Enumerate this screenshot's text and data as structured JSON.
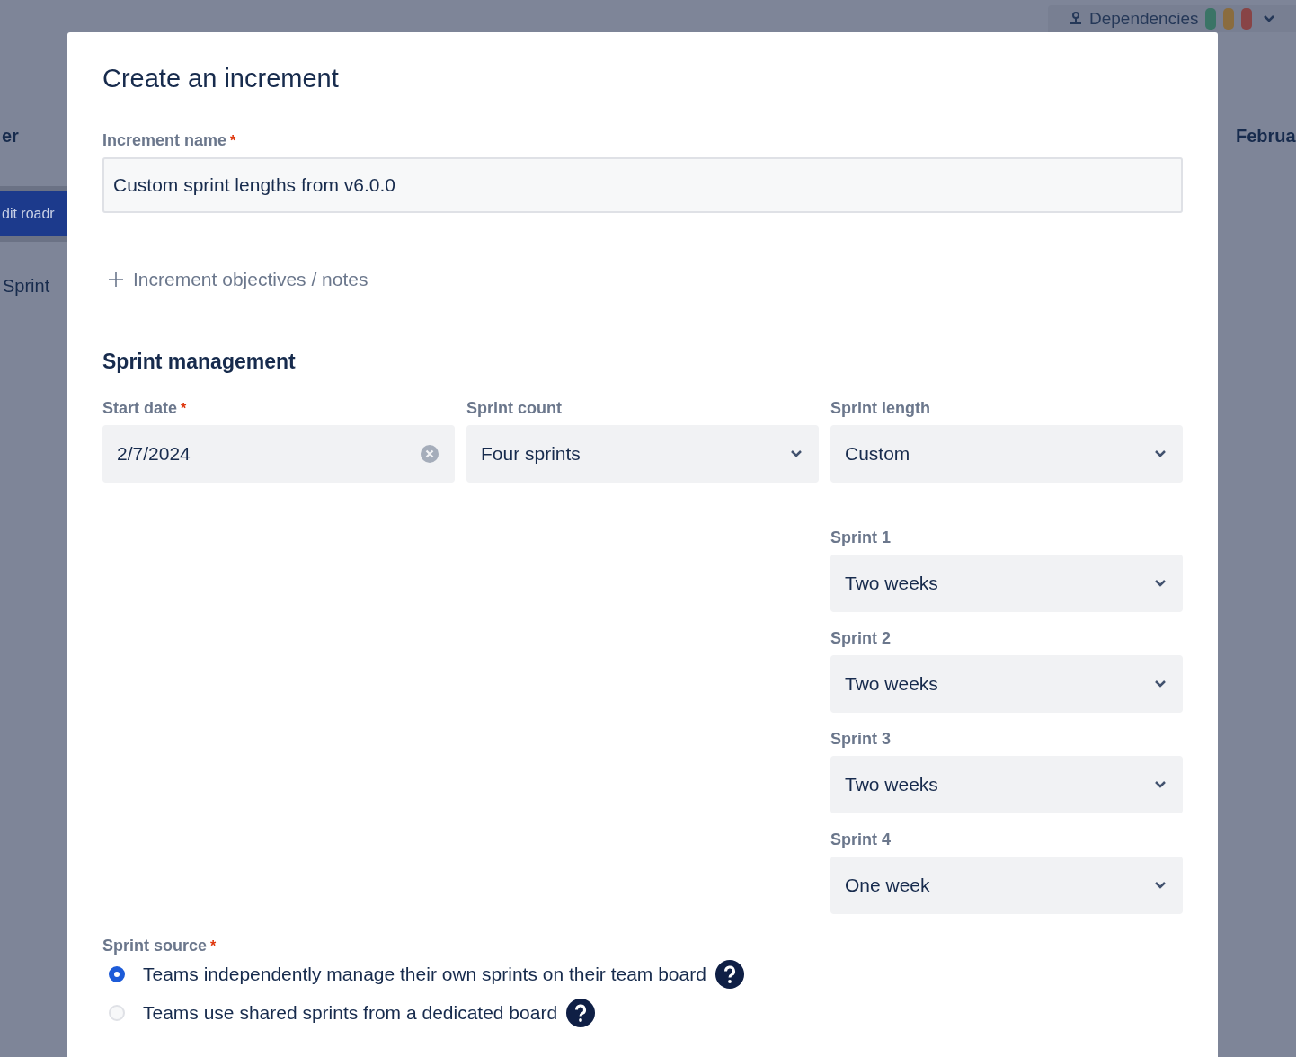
{
  "background": {
    "toolbar_label": "Dependencies",
    "status_pills": [
      {
        "color": "#3b7466"
      },
      {
        "color": "#8a6c3e"
      },
      {
        "color": "#884446"
      }
    ],
    "left_heading": "er",
    "left_button": "dit roadr",
    "left_item": "Sprint",
    "right_heading": "Februa"
  },
  "dialog": {
    "title": "Create an increment",
    "name_field": {
      "label": "Increment name",
      "required_mark": "*",
      "value": "Custom sprint lengths from v6.0.0"
    },
    "objectives_link": "Increment objectives / notes",
    "section_title": "Sprint management",
    "fields": [
      {
        "kind": "date",
        "label": "Start date",
        "required_mark": "*",
        "value": "2/7/2024"
      },
      {
        "kind": "select",
        "label": "Sprint count",
        "value": "Four sprints"
      },
      {
        "kind": "select",
        "label": "Sprint length",
        "value": "Custom"
      }
    ],
    "sprints": [
      {
        "label": "Sprint 1",
        "value": "Two weeks"
      },
      {
        "label": "Sprint 2",
        "value": "Two weeks"
      },
      {
        "label": "Sprint 3",
        "value": "Two weeks"
      },
      {
        "label": "Sprint 4",
        "value": "One week"
      }
    ],
    "source": {
      "label": "Sprint source",
      "required_mark": "*",
      "options": [
        {
          "label": "Teams independently manage their own sprints on their team board",
          "selected": true
        },
        {
          "label": "Teams use shared sprints from a dedicated board",
          "selected": false
        }
      ]
    }
  }
}
